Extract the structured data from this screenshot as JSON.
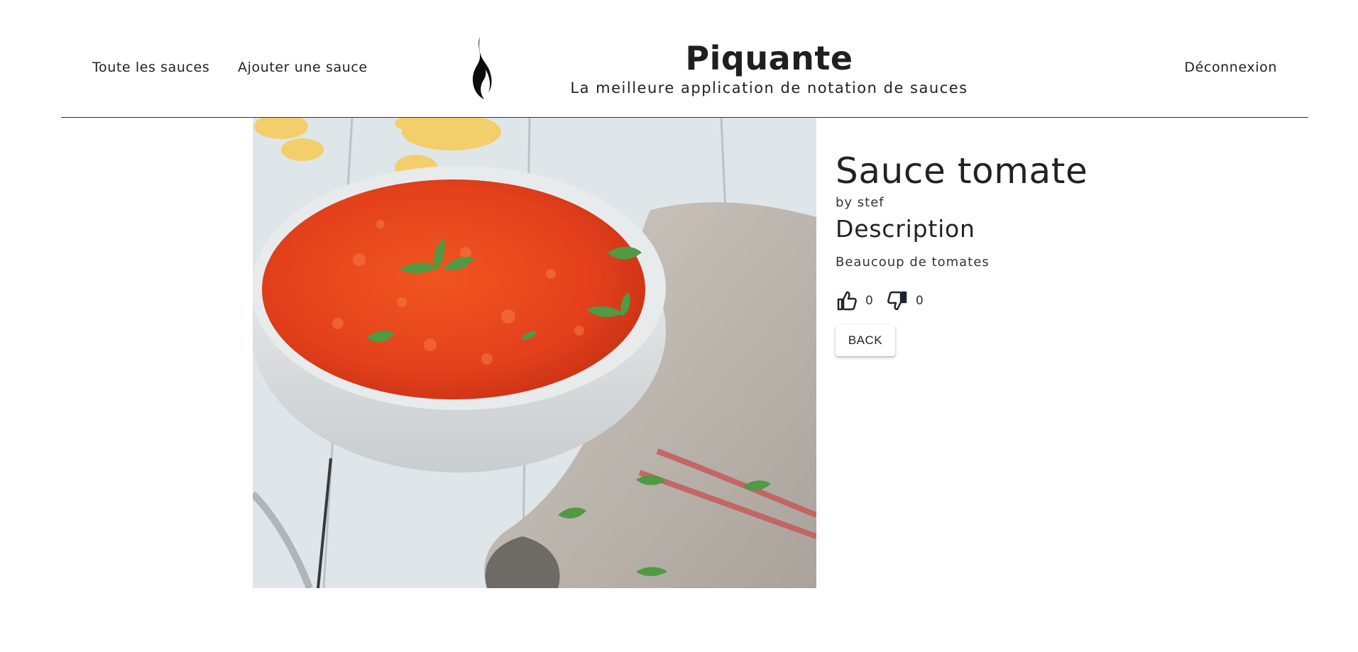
{
  "nav": {
    "all_sauces": "Toute les sauces",
    "add_sauce": "Ajouter une sauce",
    "logout": "Déconnexion"
  },
  "brand": {
    "title": "Piquante",
    "subtitle": "La meilleure application de notation de sauces",
    "logo_icon": "flame-icon"
  },
  "sauce": {
    "name": "Sauce tomate",
    "author": "by stef",
    "description_heading": "Description",
    "description": "Beaucoup de tomates",
    "likes": "0",
    "dislikes": "0",
    "image_alt": "Sauce tomate",
    "back_label": "BACK"
  },
  "icons": {
    "like": "thumbs-up-icon",
    "dislike": "thumbs-down-icon"
  },
  "colors": {
    "text": "#222222",
    "divider": "#333333",
    "sauce_red": "#e3401c",
    "table": "#dfe6ea"
  }
}
